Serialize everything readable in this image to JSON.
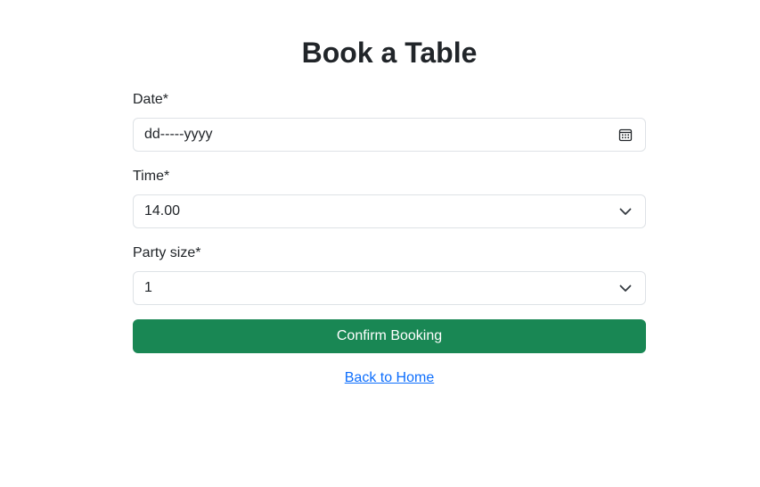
{
  "page": {
    "title": "Book a Table"
  },
  "form": {
    "date": {
      "label": "Date*",
      "placeholder": "dd-----yyyy",
      "icon": "calendar-icon"
    },
    "time": {
      "label": "Time*",
      "selected": "14.00",
      "icon": "chevron-down-icon"
    },
    "party_size": {
      "label": "Party size*",
      "selected": "1",
      "icon": "chevron-down-icon"
    },
    "submit_label": "Confirm Booking"
  },
  "links": {
    "back_home": "Back to Home"
  },
  "colors": {
    "primary_button": "#198754",
    "link": "#0d6efd",
    "border": "#dee2e6",
    "text": "#212529"
  }
}
